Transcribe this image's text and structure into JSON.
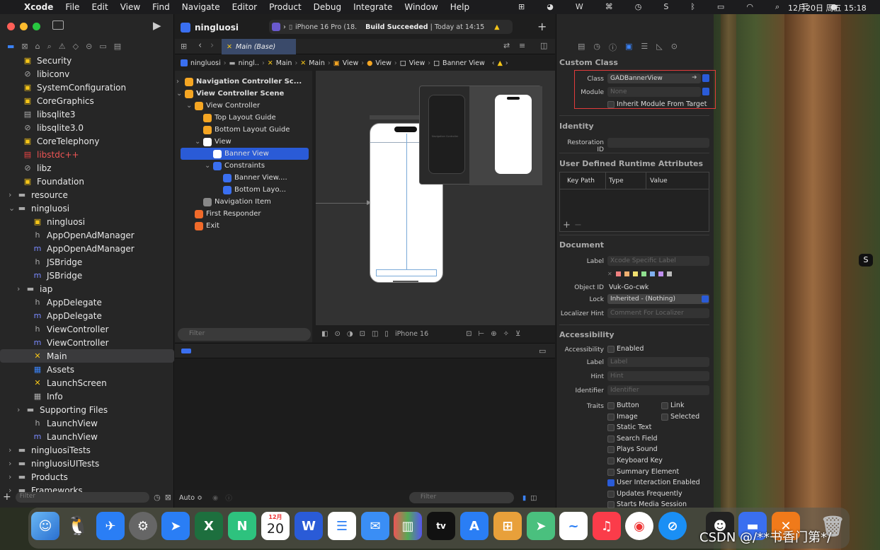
{
  "menubar": {
    "apple": "",
    "app": "Xcode",
    "items": [
      "File",
      "Edit",
      "View",
      "Find",
      "Navigate",
      "Editor",
      "Product",
      "Debug",
      "Integrate",
      "Window",
      "Help"
    ],
    "clock": "12月20日 周五  15:18"
  },
  "toolbar": {
    "project": "ningluosi",
    "device": "iPhone 16 Pro (18.",
    "build_status": "Build Succeeded",
    "build_time": "| Today at 14:15"
  },
  "tab": {
    "label": "Main (Base)"
  },
  "jumpbar": [
    "ningluosi",
    "ningl..",
    "Main",
    "Main",
    "View",
    "View",
    "View",
    "Banner View"
  ],
  "navigator": {
    "items": [
      {
        "label": "Security",
        "kind": "toolbox"
      },
      {
        "label": "libiconv",
        "kind": "link"
      },
      {
        "label": "SystemConfiguration",
        "kind": "toolbox"
      },
      {
        "label": "CoreGraphics",
        "kind": "toolbox"
      },
      {
        "label": "libsqlite3",
        "kind": "doc"
      },
      {
        "label": "libsqlite3.0",
        "kind": "link"
      },
      {
        "label": "CoreTelephony",
        "kind": "toolbox"
      },
      {
        "label": "libstdc++",
        "kind": "doc-red"
      },
      {
        "label": "libz",
        "kind": "link"
      },
      {
        "label": "Foundation",
        "kind": "toolbox"
      },
      {
        "label": "resource",
        "kind": "folder"
      },
      {
        "label": "ningluosi",
        "kind": "folder"
      },
      {
        "label": "ningluosi",
        "kind": "target"
      },
      {
        "label": "AppOpenAdManager",
        "kind": "h"
      },
      {
        "label": "AppOpenAdManager",
        "kind": "m"
      },
      {
        "label": "JSBridge",
        "kind": "h"
      },
      {
        "label": "JSBridge",
        "kind": "m"
      },
      {
        "label": "iap",
        "kind": "folder"
      },
      {
        "label": "AppDelegate",
        "kind": "h"
      },
      {
        "label": "AppDelegate",
        "kind": "m"
      },
      {
        "label": "ViewController",
        "kind": "h"
      },
      {
        "label": "ViewController",
        "kind": "m"
      },
      {
        "label": "Main",
        "kind": "xib"
      },
      {
        "label": "Assets",
        "kind": "assets"
      },
      {
        "label": "LaunchScreen",
        "kind": "xib"
      },
      {
        "label": "Info",
        "kind": "plist"
      },
      {
        "label": "Supporting Files",
        "kind": "folder"
      },
      {
        "label": "LaunchView",
        "kind": "h"
      },
      {
        "label": "LaunchView",
        "kind": "m"
      },
      {
        "label": "ningluosiTests",
        "kind": "folder"
      },
      {
        "label": "ningluosiUITests",
        "kind": "folder"
      },
      {
        "label": "Products",
        "kind": "folder"
      },
      {
        "label": "Frameworks",
        "kind": "folder"
      }
    ],
    "filter_placeholder": "Filter"
  },
  "outline": {
    "rows": [
      {
        "label": "Navigation Controller Sc...",
        "color": "#f5a623"
      },
      {
        "label": "View Controller Scene",
        "color": "#f5a623"
      },
      {
        "label": "View Controller",
        "color": "#f5a623"
      },
      {
        "label": "Top Layout Guide",
        "color": "#f5a623"
      },
      {
        "label": "Bottom Layout Guide",
        "color": "#f5a623"
      },
      {
        "label": "View",
        "color": "#ffffff"
      },
      {
        "label": "Banner View",
        "color": "#ffffff"
      },
      {
        "label": "Constraints",
        "color": "#3a6ff0"
      },
      {
        "label": "Banner View....",
        "color": "#3a6ff0"
      },
      {
        "label": "Bottom Layo...",
        "color": "#3a6ff0"
      },
      {
        "label": "Navigation Item",
        "color": "#888888"
      },
      {
        "label": "First Responder",
        "color": "#f06a2a"
      },
      {
        "label": "Exit",
        "color": "#f06a2a"
      }
    ],
    "filter_placeholder": "Filter"
  },
  "canvas": {
    "device": "iPhone 16",
    "auto": "Auto ≎",
    "popover_label": "Navigation Controller"
  },
  "inspector": {
    "custom_class": {
      "title": "Custom Class",
      "class_label": "Class",
      "class_value": "GADBannerView",
      "module_label": "Module",
      "module_value": "None",
      "inherit": "Inherit Module From Target"
    },
    "identity": {
      "title": "Identity",
      "restoration_label": "Restoration ID"
    },
    "runtime": {
      "title": "User Defined Runtime Attributes",
      "cols": [
        "Key Path",
        "Type",
        "Value"
      ]
    },
    "document": {
      "title": "Document",
      "label_label": "Label",
      "label_placeholder": "Xcode Specific Label",
      "object_id_label": "Object ID",
      "object_id": "Vuk-Go-cwk",
      "lock_label": "Lock",
      "lock_value": "Inherited - (Nothing)",
      "hint_label": "Localizer Hint",
      "hint_placeholder": "Comment For Localizer"
    },
    "accessibility": {
      "title": "Accessibility",
      "acc_label": "Accessibility",
      "enabled": "Enabled",
      "label_label": "Label",
      "label_placeholder": "Label",
      "hint_label": "Hint",
      "hint_placeholder": "Hint",
      "identifier_label": "Identifier",
      "identifier_placeholder": "Identifier",
      "traits_label": "Traits",
      "traits": [
        "Button",
        "Image",
        "Static Text",
        "Search Field",
        "Plays Sound",
        "Keyboard Key",
        "Summary Element",
        "User Interaction Enabled",
        "Updates Frequently",
        "Starts Media Session"
      ],
      "traits_right": [
        "Link",
        "Selected"
      ]
    }
  },
  "watermark": "CSDN @/**书香门第*/",
  "dock": {
    "calendar_month": "12月",
    "calendar_day": "20"
  }
}
